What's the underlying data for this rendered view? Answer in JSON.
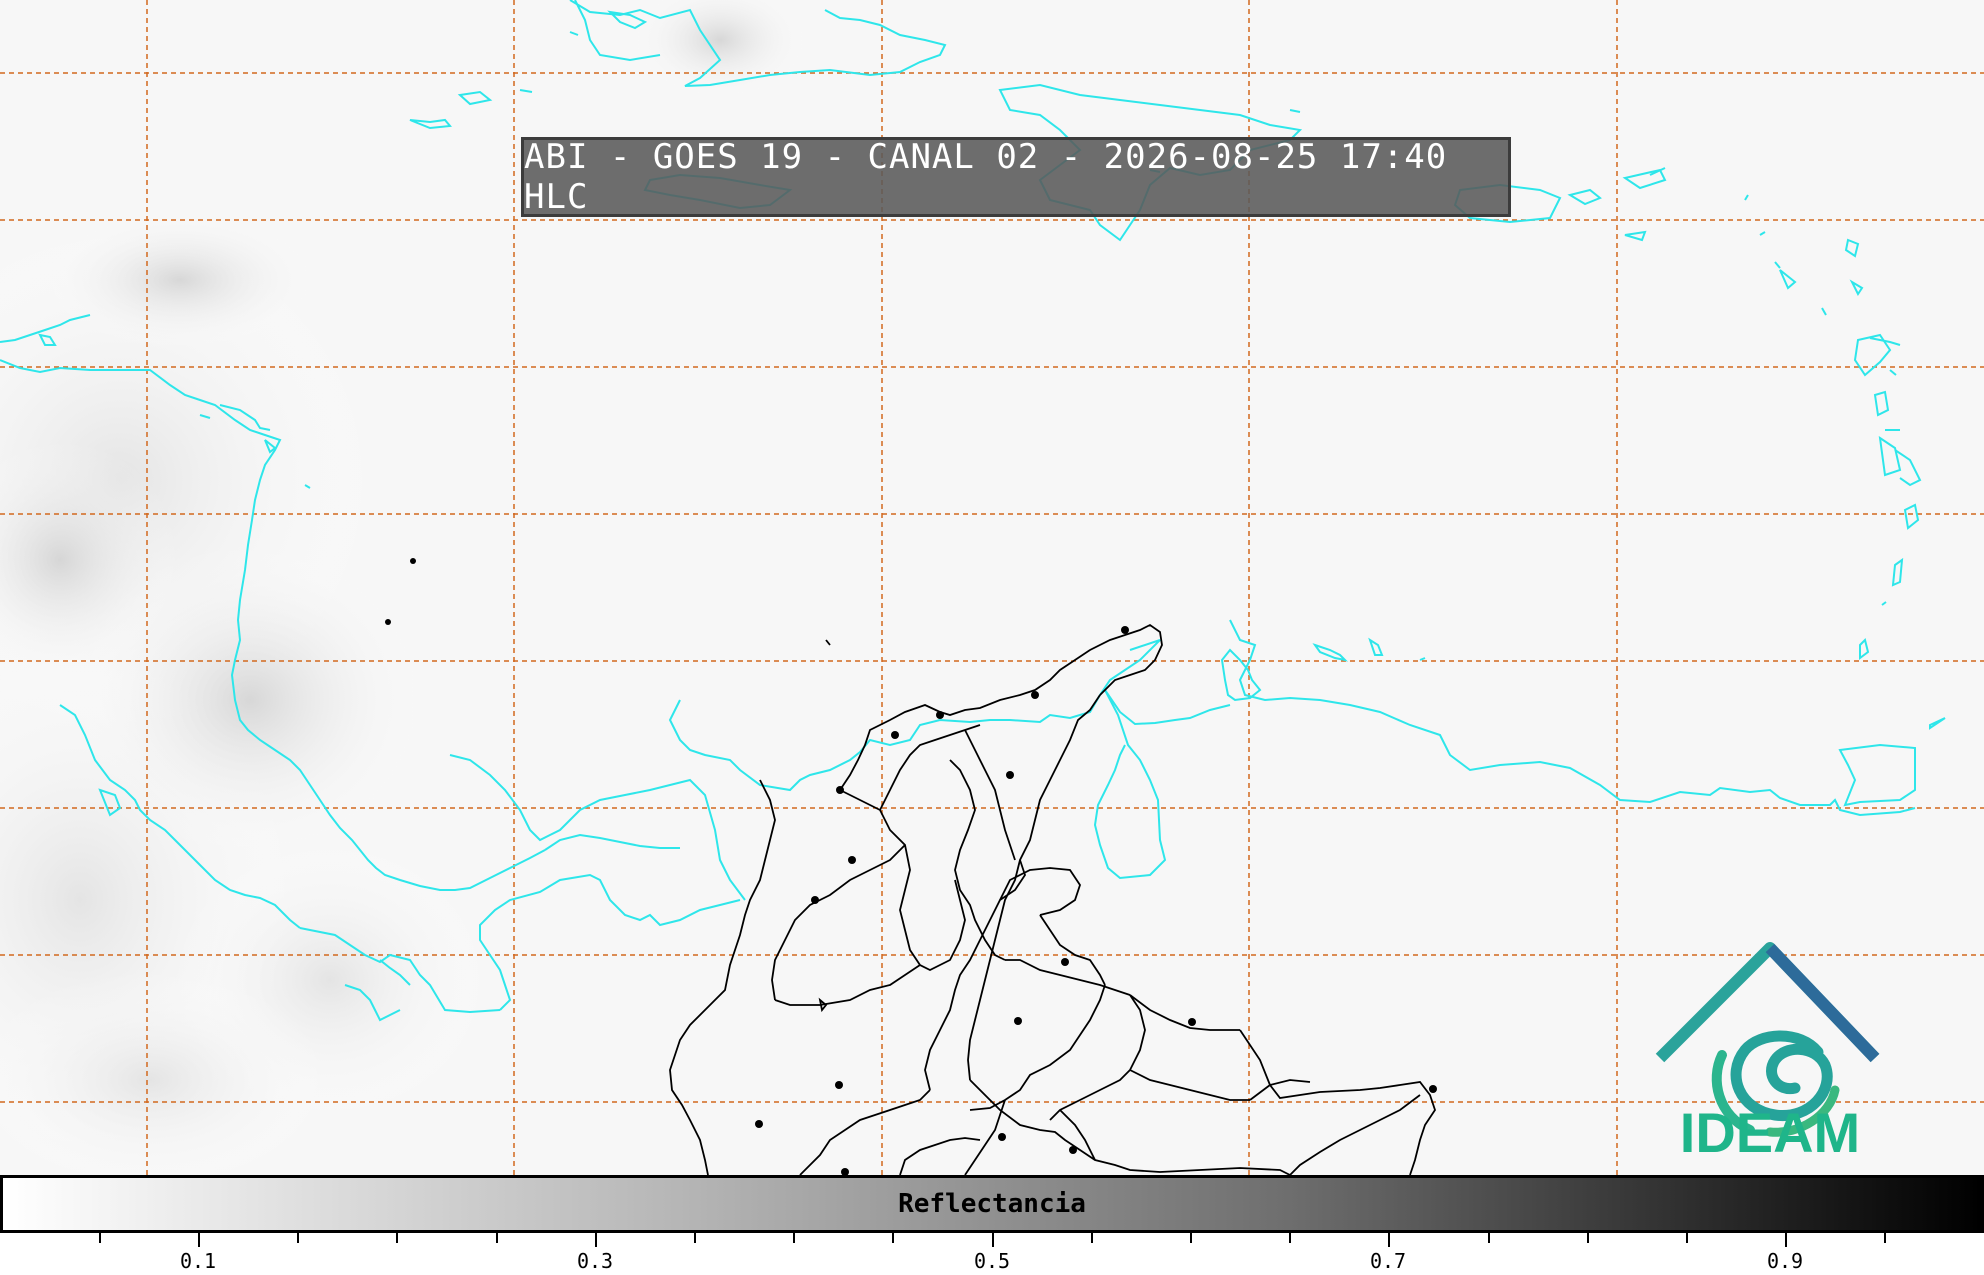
{
  "title": "ABI - GOES 19 - CANAL 02 - 2026-08-25 17:40 HLC",
  "colorbar": {
    "label": "Reflectancia",
    "range": [
      0.0,
      1.0
    ],
    "tick_labels": [
      "0.1",
      "0.3",
      "0.5",
      "0.7",
      "0.9"
    ],
    "colors": [
      "#ffffff",
      "#000000"
    ]
  },
  "logo": {
    "text": "IDEAM",
    "icon": "ideam-mountain-swirl-icon",
    "color": "#1fb58a"
  },
  "map": {
    "coastline_color": "#2ee6ea",
    "border_color": "#000000",
    "grid_color": "#d2691e",
    "grid": true
  }
}
